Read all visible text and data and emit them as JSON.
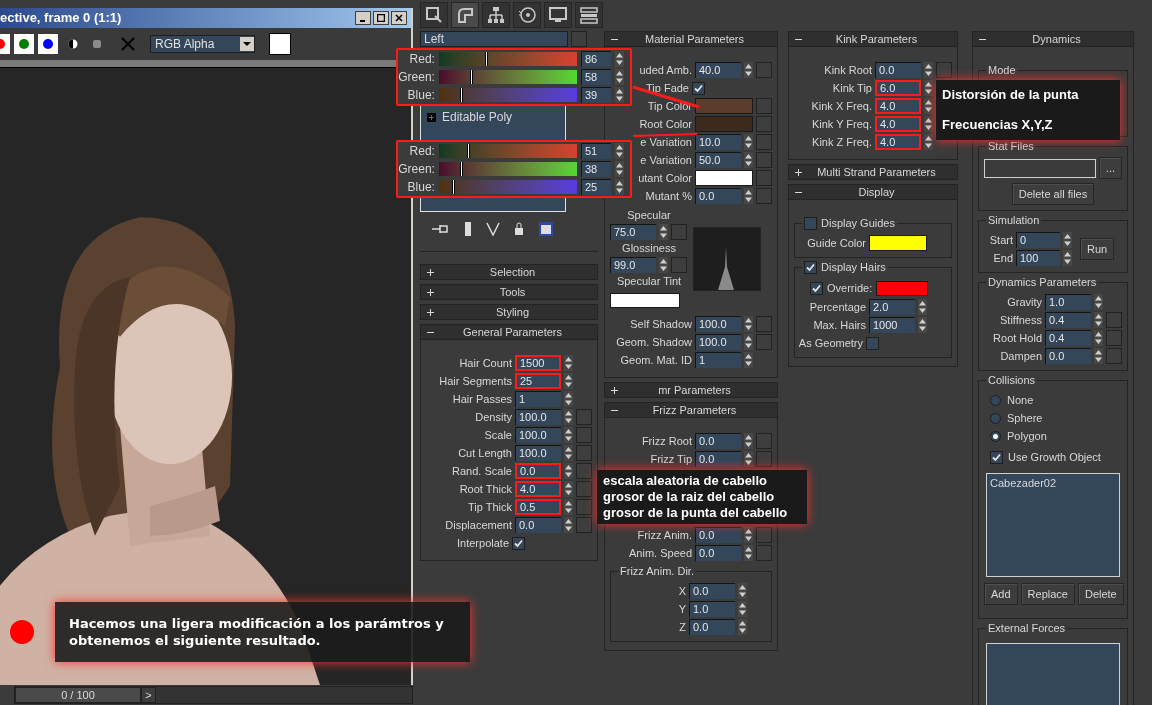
{
  "viewport": {
    "title": "ective, frame 0 (1:1)",
    "channel_buttons": [
      {
        "color": "#ff0000"
      },
      {
        "color": "#008000"
      },
      {
        "color": "#0000ff"
      }
    ],
    "channel": "RGB Alpha",
    "caption": "Hacemos una ligera modificación a los parámtros y obtenemos el siguiente resultado.",
    "time_slider": {
      "label": "0 / 100"
    },
    "next_button": ">"
  },
  "command_tabs": [
    {
      "kind": "create",
      "selected": false
    },
    {
      "kind": "modify",
      "selected": true
    },
    {
      "kind": "hierarchy",
      "selected": false
    },
    {
      "kind": "motion",
      "selected": false
    },
    {
      "kind": "display",
      "selected": false
    },
    {
      "kind": "utilities",
      "selected": false
    }
  ],
  "modifier_stack": {
    "name": "Left",
    "items": [
      "Editable Poly"
    ]
  },
  "color_pickers": [
    {
      "channels": [
        {
          "label": "Red:",
          "value": "86",
          "level": 0.337
        },
        {
          "label": "Green:",
          "value": "58",
          "level": 0.227
        },
        {
          "label": "Blue:",
          "value": "39",
          "level": 0.153
        }
      ]
    },
    {
      "channels": [
        {
          "label": "Red:",
          "value": "51",
          "level": 0.2
        },
        {
          "label": "Green:",
          "value": "38",
          "level": 0.149
        },
        {
          "label": "Blue:",
          "value": "25",
          "level": 0.098
        }
      ]
    }
  ],
  "columns": [
    [
      {
        "title": "Selection",
        "expanded": false
      },
      {
        "title": "Tools",
        "expanded": false
      },
      {
        "title": "Styling",
        "expanded": false
      },
      {
        "title": "General Parameters",
        "expanded": true,
        "rows": [
          {
            "kind": "spinner",
            "label": "Hair Count",
            "value": "1500",
            "map": false,
            "highlighted": true
          },
          {
            "kind": "spinner",
            "label": "Hair Segments",
            "value": "25",
            "map": false,
            "highlighted": true
          },
          {
            "kind": "spinner",
            "label": "Hair Passes",
            "value": "1",
            "map": false,
            "highlighted": false
          },
          {
            "kind": "spinner",
            "label": "Density",
            "value": "100.0",
            "map": true,
            "highlighted": false
          },
          {
            "kind": "spinner",
            "label": "Scale",
            "value": "100.0",
            "map": true,
            "highlighted": false
          },
          {
            "kind": "spinner",
            "label": "Cut Length",
            "value": "100.0",
            "map": true,
            "highlighted": false
          },
          {
            "kind": "spinner",
            "label": "Rand. Scale",
            "value": "0.0",
            "map": true,
            "highlighted": true
          },
          {
            "kind": "spinner",
            "label": "Root Thick",
            "value": "4.0",
            "map": true,
            "highlighted": true
          },
          {
            "kind": "spinner",
            "label": "Tip Thick",
            "value": "0.5",
            "map": true,
            "highlighted": true
          },
          {
            "kind": "spinner",
            "label": "Displacement",
            "value": "0.0",
            "map": true,
            "highlighted": false
          },
          {
            "kind": "check",
            "label": "Interpolate",
            "checked": true
          }
        ]
      }
    ],
    [
      {
        "title": "Material Parameters",
        "expanded": true,
        "rows": [
          {
            "kind": "spinner",
            "label": "uded Amb.",
            "value": "40.0",
            "map": true
          },
          {
            "kind": "check",
            "label": "Tip Fade",
            "checked": true
          },
          {
            "kind": "swatch",
            "label": "Tip Color",
            "color": "#5b3d2d",
            "map": true
          },
          {
            "kind": "swatch",
            "label": "Root Color",
            "color": "#3b2a1e",
            "map": true
          },
          {
            "kind": "spinner",
            "label": "e Variation",
            "value": "10.0",
            "map": true
          },
          {
            "kind": "spinner",
            "label": "e Variation",
            "value": "50.0",
            "map": true
          },
          {
            "kind": "swatch",
            "label": "utant Color",
            "color": "#ffffff",
            "map": true
          },
          {
            "kind": "spinner",
            "label": "Mutant %",
            "value": "0.0",
            "map": true
          },
          {
            "kind": "specular_block",
            "rows": [
              {
                "kind": "heading",
                "label": "Specular"
              },
              {
                "kind": "bare_spinner",
                "value": "75.0",
                "map": true
              },
              {
                "kind": "heading",
                "label": "Glossiness"
              },
              {
                "kind": "bare_spinner",
                "value": "99.0",
                "map": true
              },
              {
                "kind": "heading",
                "label": "Specular Tint"
              },
              {
                "kind": "bare_swatch",
                "color": "#ffffff"
              }
            ]
          },
          {
            "kind": "spinner",
            "label": "Self Shadow",
            "value": "100.0",
            "map": true
          },
          {
            "kind": "spinner",
            "label": "Geom. Shadow",
            "value": "100.0",
            "map": true
          },
          {
            "kind": "spinner",
            "label": "Geom. Mat. ID",
            "value": "1",
            "map": false
          }
        ]
      },
      {
        "title": "mr Parameters",
        "expanded": false
      },
      {
        "title": "Frizz Parameters",
        "expanded": true,
        "rows": [
          {
            "kind": "spinner",
            "label": "Frizz Root",
            "value": "0.0",
            "map": true
          },
          {
            "kind": "spinner",
            "label": "Frizz Tip",
            "value": "0.0",
            "map": true
          }
        ],
        "lower_rows": [
          {
            "kind": "spinner",
            "label": "Frizz Anim.",
            "value": "0.0",
            "map": true
          },
          {
            "kind": "spinner",
            "label": "Anim. Speed",
            "value": "0.0",
            "map": true
          },
          {
            "kind": "group",
            "label": "Frizz Anim. Dir.",
            "rows": [
              {
                "kind": "spinner",
                "label": "X",
                "value": "0.0",
                "map": false
              },
              {
                "kind": "spinner",
                "label": "Y",
                "value": "1.0",
                "map": false
              },
              {
                "kind": "spinner",
                "label": "Z",
                "value": "0.0",
                "map": false
              }
            ]
          }
        ]
      }
    ],
    [
      {
        "title": "Kink Parameters",
        "expanded": true,
        "rows": [
          {
            "kind": "spinner",
            "label": "Kink Root",
            "value": "0.0",
            "map": true,
            "highlighted": false
          },
          {
            "kind": "spinner",
            "label": "Kink Tip",
            "value": "6.0",
            "map": false,
            "highlighted": true
          },
          {
            "kind": "spinner",
            "label": "Kink X Freq.",
            "value": "4.0",
            "map": false,
            "highlighted": true
          },
          {
            "kind": "spinner",
            "label": "Kink Y Freq.",
            "value": "4.0",
            "map": false,
            "highlighted": true
          },
          {
            "kind": "spinner",
            "label": "Kink Z Freq.",
            "value": "4.0",
            "map": false,
            "highlighted": true
          }
        ]
      },
      {
        "title": "Multi Strand Parameters",
        "expanded": false
      },
      {
        "title": "Display",
        "expanded": true,
        "rows": [
          {
            "kind": "check_group",
            "label": "Display Guides",
            "checked": false,
            "rows": [
              {
                "kind": "swatch",
                "label": "Guide Color",
                "color": "#ffff00",
                "map": false
              }
            ]
          },
          {
            "kind": "check_group",
            "label": "Display Hairs",
            "checked": true,
            "rows": [
              {
                "kind": "check_swatch",
                "label": "Override:",
                "checked": true,
                "color": "#ff0000"
              },
              {
                "kind": "spinner",
                "label": "Percentage",
                "value": "2.0",
                "map": false
              },
              {
                "kind": "spinner",
                "label": "Max. Hairs",
                "value": "1000",
                "map": false
              },
              {
                "kind": "check",
                "label": "As Geometry",
                "checked": false
              }
            ]
          }
        ]
      }
    ],
    [
      {
        "title": "Dynamics",
        "expanded": true,
        "rows": [
          {
            "kind": "group",
            "label": "Mode"
          },
          {
            "kind": "group",
            "label": "Stat Files",
            "rows": [
              {
                "kind": "file_field",
                "button": "..."
              },
              {
                "kind": "button",
                "label": "Delete all files"
              }
            ]
          },
          {
            "kind": "group",
            "label": "Simulation",
            "rows": [
              {
                "kind": "sim",
                "button": "Run",
                "rows": [
                  {
                    "label": "Start",
                    "value": "0"
                  },
                  {
                    "label": "End",
                    "value": "100"
                  }
                ]
              }
            ]
          },
          {
            "kind": "group",
            "label": "Dynamics Parameters",
            "rows": [
              {
                "kind": "spinner",
                "label": "Gravity",
                "value": "1.0",
                "map": false
              },
              {
                "kind": "spinner",
                "label": "Stiffness",
                "value": "0.4",
                "map": true
              },
              {
                "kind": "spinner",
                "label": "Root Hold",
                "value": "0.4",
                "map": true
              },
              {
                "kind": "spinner",
                "label": "Dampen",
                "value": "0.0",
                "map": true
              }
            ]
          },
          {
            "kind": "group",
            "label": "Collisions",
            "rows": [
              {
                "kind": "radio",
                "label": "None",
                "selected": false
              },
              {
                "kind": "radio",
                "label": "Sphere",
                "selected": false
              },
              {
                "kind": "radio",
                "label": "Polygon",
                "selected": true
              },
              {
                "kind": "check_left",
                "label": "Use Growth Object",
                "checked": true
              },
              {
                "kind": "listbox",
                "items": [
                  "Cabezader02"
                ]
              },
              {
                "kind": "buttons",
                "labels": [
                  "Add",
                  "Replace",
                  "Delete"
                ]
              }
            ]
          },
          {
            "kind": "group",
            "label": "External Forces",
            "rows": [
              {
                "kind": "listbox"
              }
            ]
          }
        ]
      }
    ]
  ],
  "callouts": [
    {
      "lines": [
        "Distorsión de la punta",
        "Frecuencias X,Y,Z"
      ]
    },
    {
      "lines": [
        "escala aleatoria de cabello",
        "grosor de la raiz del cabello",
        "grosor de la punta del cabello"
      ]
    }
  ]
}
